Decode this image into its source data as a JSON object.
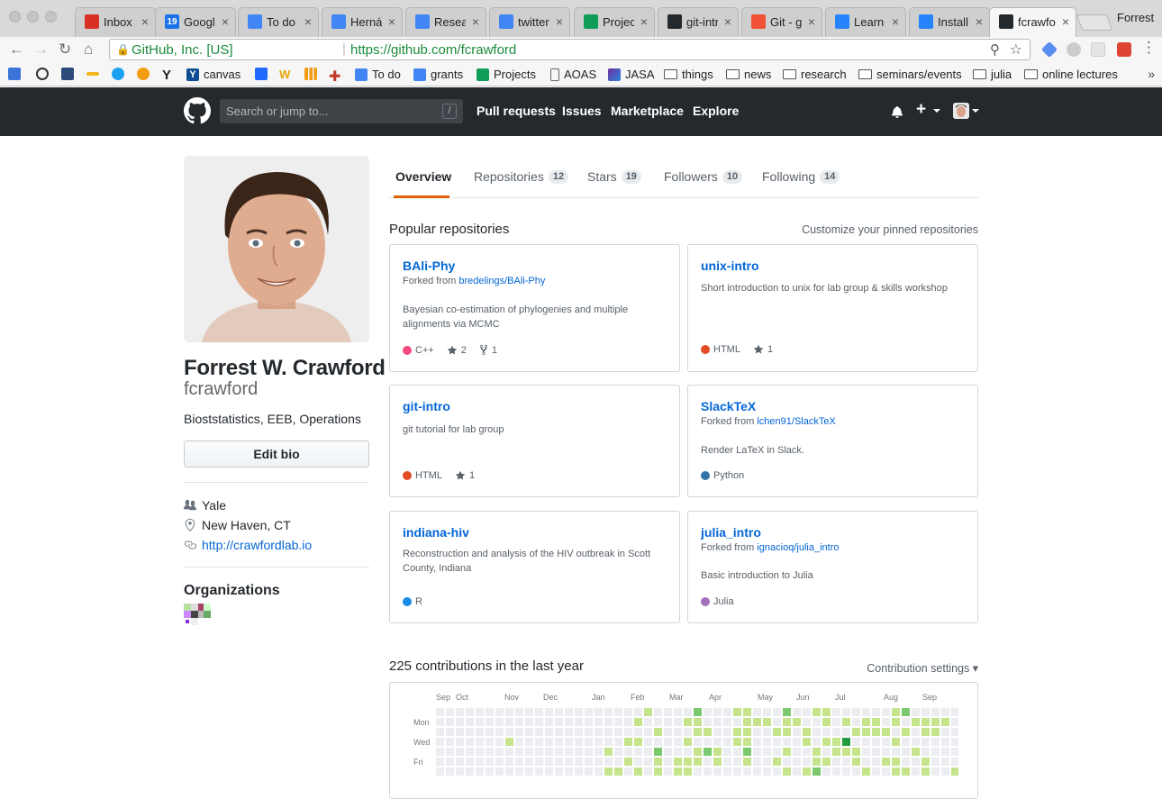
{
  "browser": {
    "tabs": [
      {
        "title": "Inbox",
        "icon": "gmail-icon",
        "color": "#d93025"
      },
      {
        "title": "Google",
        "icon": "calendar-icon",
        "color": "#1a73e8"
      },
      {
        "title": "To do",
        "icon": "docs-icon",
        "color": "#4285f4"
      },
      {
        "title": "Hernán",
        "icon": "docs-icon",
        "color": "#4285f4"
      },
      {
        "title": "Resear",
        "icon": "docs-icon",
        "color": "#4285f4"
      },
      {
        "title": "twitter",
        "icon": "docs-icon",
        "color": "#4285f4"
      },
      {
        "title": "Project",
        "icon": "sheets-icon",
        "color": "#0f9d58"
      },
      {
        "title": "git-intr",
        "icon": "github-icon",
        "color": "#24292e"
      },
      {
        "title": "Git - gi",
        "icon": "git-icon",
        "color": "#f05033"
      },
      {
        "title": "Learn",
        "icon": "atlassian-icon",
        "color": "#2684ff"
      },
      {
        "title": "Install",
        "icon": "atlassian-icon",
        "color": "#2684ff"
      },
      {
        "title": "fcrawfo",
        "icon": "github-icon",
        "color": "#24292e"
      }
    ],
    "calendar_badge": "19",
    "profile_name": "Forrest",
    "secure_label": "GitHub, Inc. [US]",
    "url": "https://github.com/fcrawford",
    "bookmarks": [
      {
        "label": "canvas",
        "icon": "yale-y-icon"
      },
      {
        "label": "To do",
        "icon": "docs-icon"
      },
      {
        "label": "grants",
        "icon": "docs-icon"
      },
      {
        "label": "Projects",
        "icon": "sheets-icon"
      },
      {
        "label": "AOAS",
        "icon": "page-icon"
      },
      {
        "label": "JASA",
        "icon": "jasa-icon"
      },
      {
        "label": "things",
        "icon": "folder-icon"
      },
      {
        "label": "news",
        "icon": "folder-icon"
      },
      {
        "label": "research",
        "icon": "folder-icon"
      },
      {
        "label": "seminars/events",
        "icon": "folder-icon"
      },
      {
        "label": "julia",
        "icon": "folder-icon"
      },
      {
        "label": "online lectures",
        "icon": "folder-icon"
      }
    ]
  },
  "github_header": {
    "search_placeholder": "Search or jump to...",
    "search_shortcut": "/",
    "nav": [
      "Pull requests",
      "Issues",
      "Marketplace",
      "Explore"
    ]
  },
  "profile": {
    "full_name": "Forrest W. Crawford",
    "username": "fcrawford",
    "bio": "Bioststatistics, EEB, Operations",
    "edit_bio_label": "Edit bio",
    "company": "Yale",
    "location": "New Haven, CT",
    "website": "http://crawfordlab.io",
    "organizations_title": "Organizations"
  },
  "profile_tabs": [
    {
      "label": "Overview",
      "count": null,
      "active": true
    },
    {
      "label": "Repositories",
      "count": "12",
      "active": false
    },
    {
      "label": "Stars",
      "count": "19",
      "active": false
    },
    {
      "label": "Followers",
      "count": "10",
      "active": false
    },
    {
      "label": "Following",
      "count": "14",
      "active": false
    }
  ],
  "popular": {
    "title": "Popular repositories",
    "customize_label": "Customize your pinned repositories",
    "repos": [
      {
        "name": "BAli-Phy",
        "forked_prefix": "Forked from ",
        "forked_from": "bredelings/BAli-Phy",
        "description": "Bayesian co-estimation of phylogenies and multiple alignments via MCMC",
        "language": "C++",
        "lang_color": "#f34b7d",
        "stars": "2",
        "forks": "1"
      },
      {
        "name": "unix-intro",
        "forked_prefix": "",
        "forked_from": "",
        "description": "Short introduction to unix for lab group & skills workshop",
        "language": "HTML",
        "lang_color": "#e34c26",
        "stars": "1",
        "forks": ""
      },
      {
        "name": "git-intro",
        "forked_prefix": "",
        "forked_from": "",
        "description": "git tutorial for lab group",
        "language": "HTML",
        "lang_color": "#e34c26",
        "stars": "1",
        "forks": ""
      },
      {
        "name": "SlackTeX",
        "forked_prefix": "Forked from ",
        "forked_from": "lchen91/SlackTeX",
        "description": "Render LaTeX in Slack.",
        "language": "Python",
        "lang_color": "#3572a5",
        "stars": "",
        "forks": ""
      },
      {
        "name": "indiana-hiv",
        "forked_prefix": "",
        "forked_from": "",
        "description": "Reconstruction and analysis of the HIV outbreak in Scott County, Indiana",
        "language": "R",
        "lang_color": "#198ce7",
        "stars": "",
        "forks": ""
      },
      {
        "name": "julia_intro",
        "forked_prefix": "Forked from ",
        "forked_from": "ignacioq/julia_intro",
        "description": "Basic introduction to Julia",
        "language": "Julia",
        "lang_color": "#a270ba",
        "stars": "",
        "forks": ""
      }
    ]
  },
  "contributions": {
    "title": "225 contributions in the last year",
    "settings_label": "Contribution settings",
    "months": [
      "Sep",
      "Oct",
      "Nov",
      "Dec",
      "Jan",
      "Feb",
      "Mar",
      "Apr",
      "May",
      "Jun",
      "Jul",
      "Aug",
      "Sep"
    ],
    "days": [
      "Mon",
      "Wed",
      "Fri"
    ],
    "colors": [
      "#ebedf0",
      "#c6e48b",
      "#7bc96f",
      "#239a3b",
      "#196127"
    ]
  }
}
